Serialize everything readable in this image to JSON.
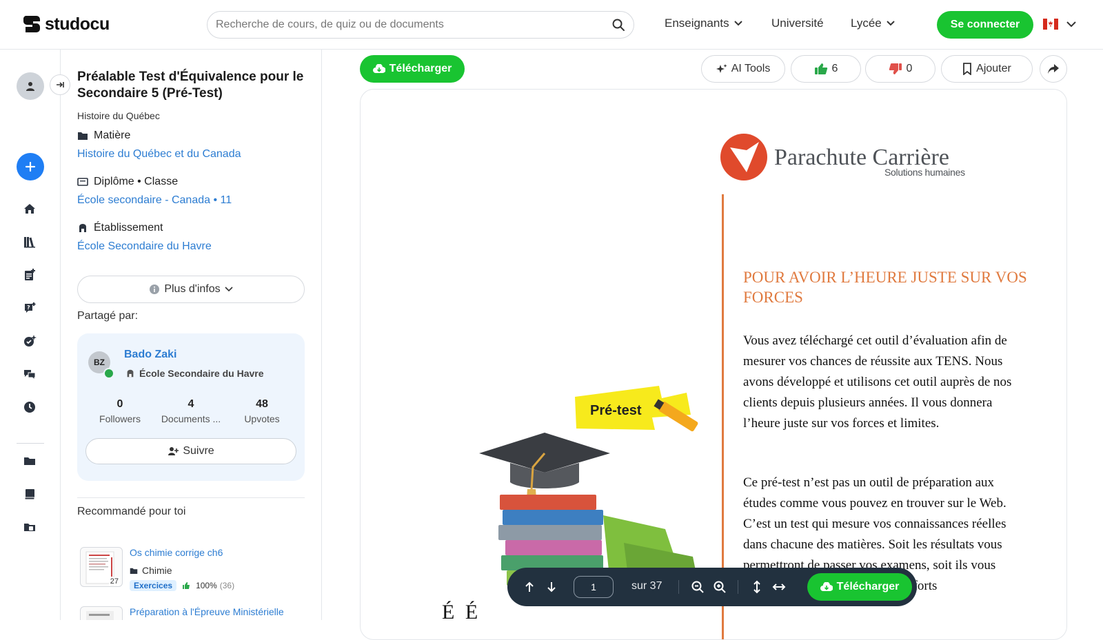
{
  "header": {
    "logo_text": "studocu",
    "search_placeholder": "Recherche de cours, de quiz ou de documents",
    "nav": [
      {
        "label": "Enseignants",
        "has_caret": true
      },
      {
        "label": "Université",
        "has_caret": false
      },
      {
        "label": "Lycée",
        "has_caret": true
      }
    ],
    "login_label": "Se connecter",
    "flag": "canada-flag-icon"
  },
  "rail": {
    "icons": [
      "home-icon",
      "library-icon",
      "notes-icon",
      "quiz-icon",
      "ai-icon",
      "chat-icon",
      "history-icon",
      "folder-icon",
      "book-icon",
      "folder-add-icon"
    ]
  },
  "document": {
    "title": "Préalable Test d'Équivalence pour le Secondaire 5 (Pré-Test)",
    "course": "Histoire du Québec",
    "subject_label": "Matière",
    "subject_value": "Histoire du Québec et du Canada",
    "degree_label": "Diplôme • Classe",
    "degree_value": "École secondaire - Canada",
    "degree_grade": "• 11",
    "institution_label": "Établissement",
    "institution_value": "École Secondaire du Havre",
    "more_info_label": "Plus d'infos"
  },
  "author": {
    "shared_by_label": "Partagé par:",
    "initials": "BZ",
    "name": "Bado Zaki",
    "school": "École Secondaire du Havre",
    "stats": [
      {
        "value": "0",
        "label": "Followers"
      },
      {
        "value": "4",
        "label": "Documents ..."
      },
      {
        "value": "48",
        "label": "Upvotes"
      }
    ],
    "follow_label": "Suivre"
  },
  "recommendations": {
    "title": "Recommandé pour toi",
    "items": [
      {
        "name": "Os chimie corrige ch6",
        "subject": "Chimie",
        "pages": "27",
        "tag": "Exercices",
        "rating": "100%",
        "count": "(36)"
      },
      {
        "name": "Préparation à l'Épreuve Ministérielle",
        "subject": "",
        "pages": "",
        "tag": "",
        "rating": "",
        "count": ""
      }
    ]
  },
  "toolbar": {
    "download_label": "Télécharger",
    "ai_tools_label": "AI Tools",
    "likes": "6",
    "dislikes": "0",
    "add_label": "Ajouter"
  },
  "page_content": {
    "company_name": "Parachute Carrière",
    "company_tagline": "Solutions humaines",
    "heading": "POUR AVOIR L’HEURE JUSTE SUR VOS FORCES",
    "para1": "Vous avez téléchargé cet outil d’évaluation afin de mesurer vos chances de réussite aux TENS. Nous avons développé et utilisons cet outil auprès de nos clients depuis plusieurs années. Il vous donnera l’heure juste sur vos forces et limites.",
    "para2": "Ce pré-test n’est pas un outil de préparation aux études comme vous pouvez en trouver sur le Web. C’est un test qui mesure vos connaissances réelles dans chacune des matières. Soit les résultats vous permettront de passer vos examens, soit ils vous indiqueront où concentrer vos efforts",
    "pretest_label": "Pré-test",
    "bottom_title_fragment": "É        É"
  },
  "viewer": {
    "page_value": "1",
    "total_label": "sur 37",
    "download_label": "Télécharger"
  },
  "colors": {
    "brand_green": "#19c431",
    "link_blue": "#2d7dd2",
    "accent_orange": "#e07a3f",
    "viewer_bg": "#22313f"
  }
}
